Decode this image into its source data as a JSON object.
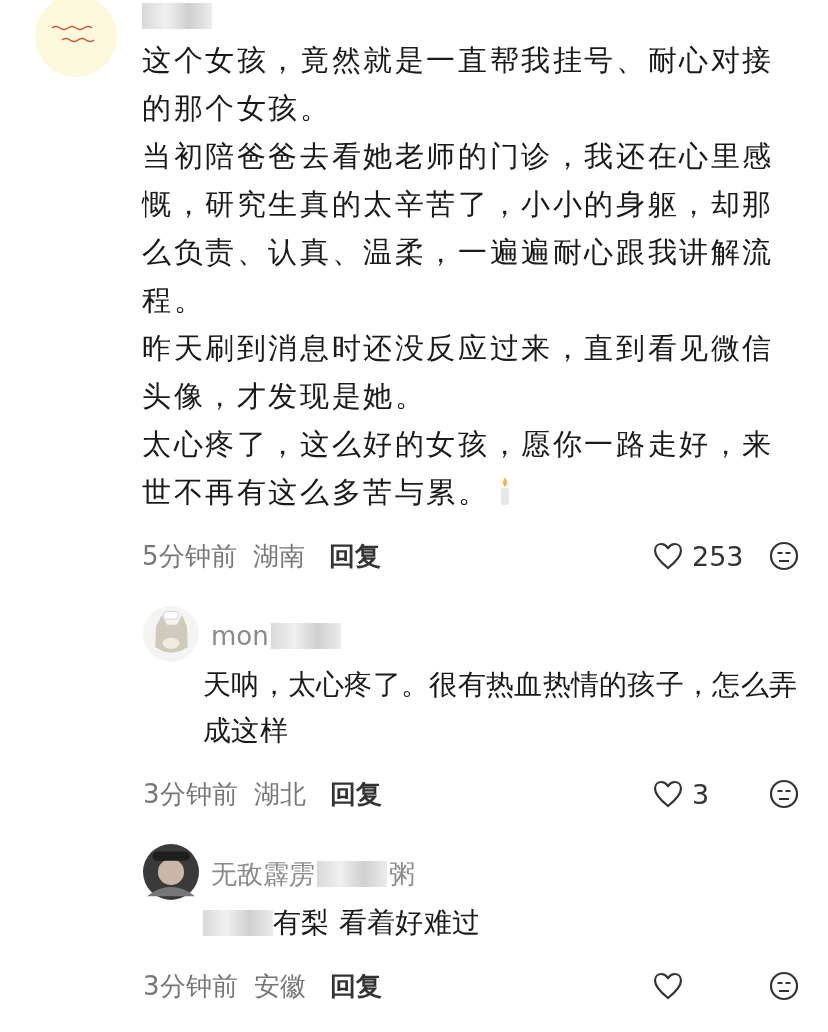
{
  "comment": {
    "name_parts": [
      {
        "kind": "blur"
      }
    ],
    "paragraphs": [
      "这个女孩，竟然就是一直帮我挂号、耐心对接的那个女孩。",
      "当初陪爸爸去看她老师的门诊，我还在心里感慨，研究生真的太辛苦了，小小的身躯，却那么负责、认真、温柔，一遍遍耐心跟我讲解流程。",
      "昨天刷到消息时还没反应过来，直到看见微信头像，才发现是她。",
      "太心疼了，这么好的女孩，愿你一路走好，来世不再有这么多苦与累。"
    ],
    "time": "5分钟前",
    "location": "湖南",
    "reply_label": "回复",
    "likes": "253"
  },
  "replies": [
    {
      "name_parts": [
        {
          "kind": "text",
          "text": "mon"
        },
        {
          "kind": "blur"
        }
      ],
      "text_parts": [
        {
          "kind": "text",
          "text": "天呐，太心疼了。很有热血热情的孩子，怎么弄成这样"
        }
      ],
      "time": "3分钟前",
      "location": "湖北",
      "reply_label": "回复",
      "likes": "3"
    },
    {
      "name_parts": [
        {
          "kind": "text",
          "text": "无敌霹雳"
        },
        {
          "kind": "blur"
        },
        {
          "kind": "text",
          "text": "粥"
        }
      ],
      "text_parts": [
        {
          "kind": "blur"
        },
        {
          "kind": "text",
          "text": "有梨  看着好难过"
        }
      ],
      "time": "3分钟前",
      "location": "安徽",
      "reply_label": "回复"
    }
  ]
}
